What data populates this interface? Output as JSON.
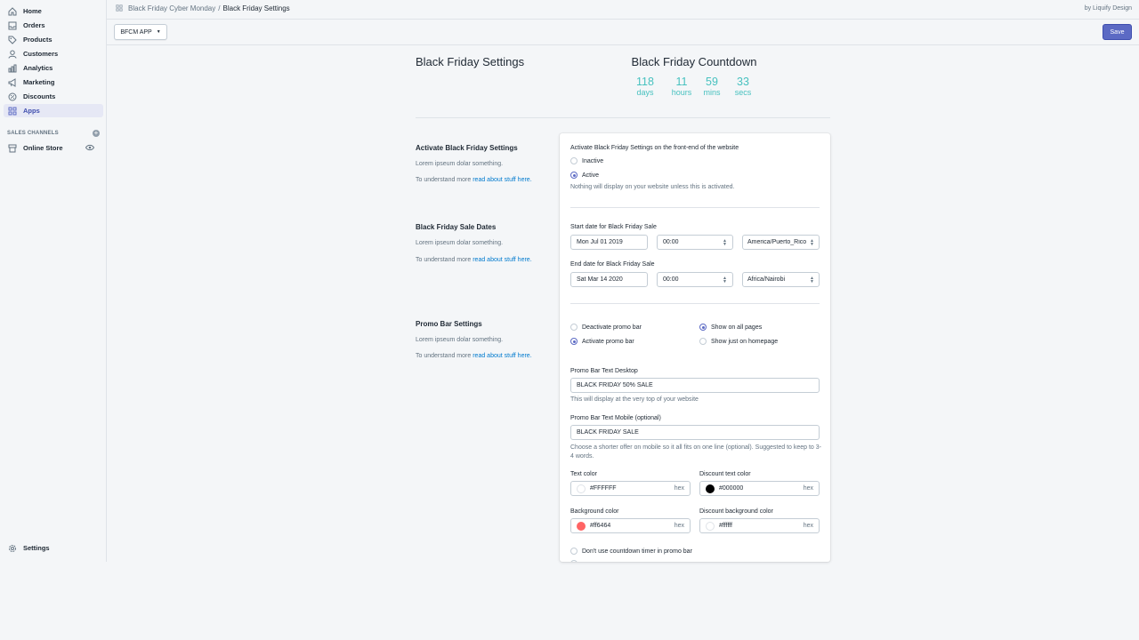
{
  "nav": {
    "items": [
      {
        "label": "Home",
        "icon": "home-icon"
      },
      {
        "label": "Orders",
        "icon": "orders-icon"
      },
      {
        "label": "Products",
        "icon": "tag-icon"
      },
      {
        "label": "Customers",
        "icon": "person-icon"
      },
      {
        "label": "Analytics",
        "icon": "bar-chart-icon"
      },
      {
        "label": "Marketing",
        "icon": "megaphone-icon"
      },
      {
        "label": "Discounts",
        "icon": "discount-icon"
      },
      {
        "label": "Apps",
        "icon": "apps-icon"
      }
    ],
    "channels_header": "SALES CHANNELS",
    "online_store": "Online Store",
    "settings": "Settings"
  },
  "topbar": {
    "crumb_parent": "Black Friday Cyber Monday",
    "crumb_separator": "/",
    "crumb_current": "Black Friday Settings",
    "byline": "by Liquify Design"
  },
  "toolbar": {
    "app_select": "BFCM APP",
    "save_label": "Save"
  },
  "header": {
    "title": "Black Friday Settings",
    "countdown_title": "Black Friday Countdown",
    "countdown": [
      {
        "value": "118",
        "unit": "days"
      },
      {
        "value": "11",
        "unit": "hours"
      },
      {
        "value": "59",
        "unit": "mins"
      },
      {
        "value": "33",
        "unit": "secs"
      }
    ]
  },
  "sections": {
    "activate": {
      "title": "Activate Black Friday Settings",
      "desc": "Lorem ipseum dolar something.",
      "link_prefix": "To understand more",
      "link": "read about stuff here.",
      "field_label": "Activate Black Friday Settings on the front-end of the website",
      "opt_inactive": "Inactive",
      "opt_active": "Active",
      "help": "Nothing will display on your website unless this is activated."
    },
    "dates": {
      "title": "Black Friday Sale Dates",
      "desc": "Lorem ipseum dolar something.",
      "link_prefix": "To understand more",
      "link": "read about stuff here.",
      "start_label": "Start date for Black Friday Sale",
      "start_date": "Mon Jul 01 2019",
      "start_time": "00:00",
      "start_tz": "America/Puerto_Rico",
      "end_label": "End date for Black Friday Sale",
      "end_date": "Sat Mar 14 2020",
      "end_time": "00:00",
      "end_tz": "Africa/Nairobi"
    },
    "promo": {
      "title": "Promo Bar Settings",
      "desc": "Lorem ipseum dolar something.",
      "link_prefix": "To understand more",
      "link": "read about stuff here.",
      "opt_deactivate": "Deactivate promo bar",
      "opt_activate": "Activate promo bar",
      "opt_all_pages": "Show on all pages",
      "opt_homepage": "Show just on homepage",
      "desktop_label": "Promo Bar Text Desktop",
      "desktop_value": "BLACK FRIDAY 50% SALE",
      "desktop_help": "This will display at the very top of your website",
      "mobile_label": "Promo Bar Text Mobile (optional)",
      "mobile_value": "BLACK FRIDAY SALE",
      "mobile_help": "Choose a shorter offer on mobile so it all fits on one line (optional). Suggested to keep to 3-4 words.",
      "text_color_label": "Text color",
      "text_color_value": "#FFFFFF",
      "discount_text_color_label": "Discount text color",
      "discount_text_color_value": "#000000",
      "bg_color_label": "Background color",
      "bg_color_value": "#ff6464",
      "discount_bg_color_label": "Discount background color",
      "discount_bg_color_value": "#ffffff",
      "hex_suffix": "hex",
      "opt_no_countdown": "Don't use countdown timer in promo bar"
    }
  },
  "colors": {
    "accent": "#5c6ac4",
    "countdown": "#47c1bf",
    "link": "#007ace",
    "swatch_bg": "#ff6464"
  }
}
